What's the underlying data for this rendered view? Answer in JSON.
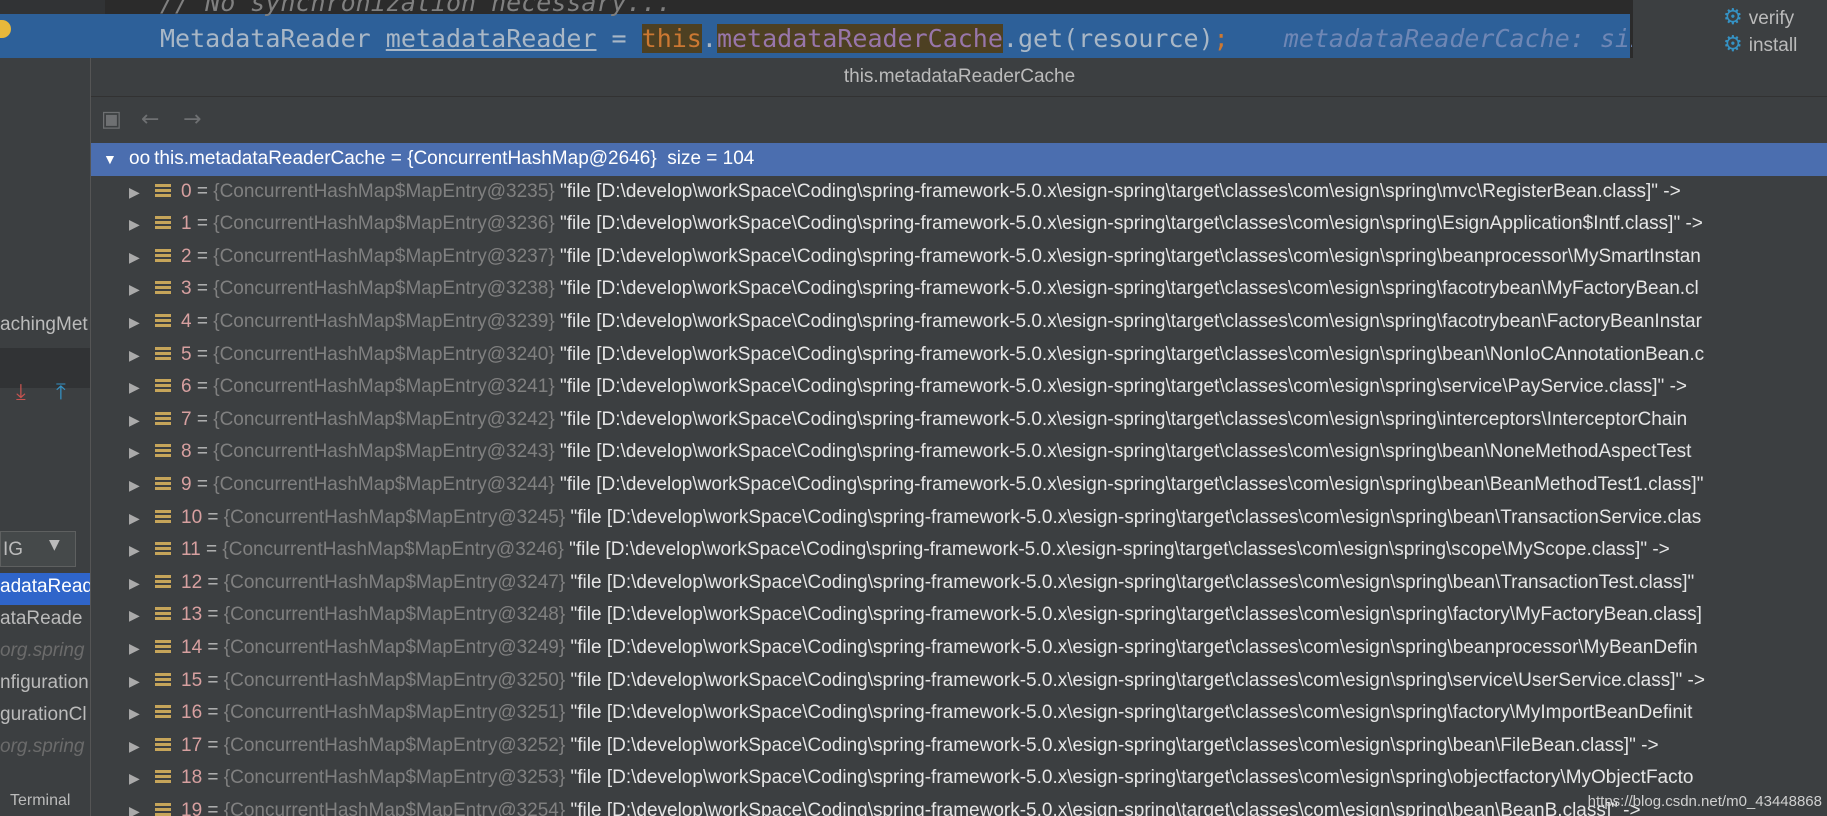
{
  "editor": {
    "prev_line": "// No synchronization necessary...",
    "code": {
      "type": "MetadataReader",
      "var": "metadataReader",
      "assign": " = ",
      "this_kw": "this",
      "dot": ".",
      "field": "metadataReaderCache",
      "call": ".get(resource)",
      "semi": ";",
      "hint": "metadataReaderCache:  size"
    }
  },
  "right_tool": {
    "items": [
      "verify",
      "install"
    ]
  },
  "left_panel": {
    "items": [
      "achingMet",
      "IG",
      "adataRead",
      "ataReade",
      "org.spring",
      "nfiguration",
      "gurationCl",
      "org.spring"
    ],
    "bottom_tab": "Terminal"
  },
  "popup": {
    "title": "this.metadataReaderCache",
    "root": {
      "label": "this.metadataReaderCache",
      "value": "{ConcurrentHashMap@2646}",
      "size": "size = 104"
    },
    "entries": [
      {
        "i": "0",
        "t": "{ConcurrentHashMap$MapEntry@3235}",
        "v": "\"file [D:\\develop\\workSpace\\Coding\\spring-framework-5.0.x\\esign-spring\\target\\classes\\com\\esign\\spring\\mvc\\RegisterBean.class]\" ->"
      },
      {
        "i": "1",
        "t": "{ConcurrentHashMap$MapEntry@3236}",
        "v": "\"file [D:\\develop\\workSpace\\Coding\\spring-framework-5.0.x\\esign-spring\\target\\classes\\com\\esign\\spring\\EsignApplication$Intf.class]\" ->"
      },
      {
        "i": "2",
        "t": "{ConcurrentHashMap$MapEntry@3237}",
        "v": "\"file [D:\\develop\\workSpace\\Coding\\spring-framework-5.0.x\\esign-spring\\target\\classes\\com\\esign\\spring\\beanprocessor\\MySmartInstan"
      },
      {
        "i": "3",
        "t": "{ConcurrentHashMap$MapEntry@3238}",
        "v": "\"file [D:\\develop\\workSpace\\Coding\\spring-framework-5.0.x\\esign-spring\\target\\classes\\com\\esign\\spring\\facotrybean\\MyFactoryBean.cl"
      },
      {
        "i": "4",
        "t": "{ConcurrentHashMap$MapEntry@3239}",
        "v": "\"file [D:\\develop\\workSpace\\Coding\\spring-framework-5.0.x\\esign-spring\\target\\classes\\com\\esign\\spring\\facotrybean\\FactoryBeanInstar"
      },
      {
        "i": "5",
        "t": "{ConcurrentHashMap$MapEntry@3240}",
        "v": "\"file [D:\\develop\\workSpace\\Coding\\spring-framework-5.0.x\\esign-spring\\target\\classes\\com\\esign\\spring\\bean\\NonIoCAnnotationBean.c"
      },
      {
        "i": "6",
        "t": "{ConcurrentHashMap$MapEntry@3241}",
        "v": "\"file [D:\\develop\\workSpace\\Coding\\spring-framework-5.0.x\\esign-spring\\target\\classes\\com\\esign\\spring\\service\\PayService.class]\" ->"
      },
      {
        "i": "7",
        "t": "{ConcurrentHashMap$MapEntry@3242}",
        "v": "\"file [D:\\develop\\workSpace\\Coding\\spring-framework-5.0.x\\esign-spring\\target\\classes\\com\\esign\\spring\\interceptors\\InterceptorChain"
      },
      {
        "i": "8",
        "t": "{ConcurrentHashMap$MapEntry@3243}",
        "v": "\"file [D:\\develop\\workSpace\\Coding\\spring-framework-5.0.x\\esign-spring\\target\\classes\\com\\esign\\spring\\bean\\NoneMethodAspectTest"
      },
      {
        "i": "9",
        "t": "{ConcurrentHashMap$MapEntry@3244}",
        "v": "\"file [D:\\develop\\workSpace\\Coding\\spring-framework-5.0.x\\esign-spring\\target\\classes\\com\\esign\\spring\\bean\\BeanMethodTest1.class]\""
      },
      {
        "i": "10",
        "t": "{ConcurrentHashMap$MapEntry@3245}",
        "v": "\"file [D:\\develop\\workSpace\\Coding\\spring-framework-5.0.x\\esign-spring\\target\\classes\\com\\esign\\spring\\bean\\TransactionService.clas"
      },
      {
        "i": "11",
        "t": "{ConcurrentHashMap$MapEntry@3246}",
        "v": "\"file [D:\\develop\\workSpace\\Coding\\spring-framework-5.0.x\\esign-spring\\target\\classes\\com\\esign\\spring\\scope\\MyScope.class]\" ->"
      },
      {
        "i": "12",
        "t": "{ConcurrentHashMap$MapEntry@3247}",
        "v": "\"file [D:\\develop\\workSpace\\Coding\\spring-framework-5.0.x\\esign-spring\\target\\classes\\com\\esign\\spring\\bean\\TransactionTest.class]\""
      },
      {
        "i": "13",
        "t": "{ConcurrentHashMap$MapEntry@3248}",
        "v": "\"file [D:\\develop\\workSpace\\Coding\\spring-framework-5.0.x\\esign-spring\\target\\classes\\com\\esign\\spring\\factory\\MyFactoryBean.class]"
      },
      {
        "i": "14",
        "t": "{ConcurrentHashMap$MapEntry@3249}",
        "v": "\"file [D:\\develop\\workSpace\\Coding\\spring-framework-5.0.x\\esign-spring\\target\\classes\\com\\esign\\spring\\beanprocessor\\MyBeanDefin"
      },
      {
        "i": "15",
        "t": "{ConcurrentHashMap$MapEntry@3250}",
        "v": "\"file [D:\\develop\\workSpace\\Coding\\spring-framework-5.0.x\\esign-spring\\target\\classes\\com\\esign\\spring\\service\\UserService.class]\" ->"
      },
      {
        "i": "16",
        "t": "{ConcurrentHashMap$MapEntry@3251}",
        "v": "\"file [D:\\develop\\workSpace\\Coding\\spring-framework-5.0.x\\esign-spring\\target\\classes\\com\\esign\\spring\\factory\\MyImportBeanDefinit"
      },
      {
        "i": "17",
        "t": "{ConcurrentHashMap$MapEntry@3252}",
        "v": "\"file [D:\\develop\\workSpace\\Coding\\spring-framework-5.0.x\\esign-spring\\target\\classes\\com\\esign\\spring\\bean\\FileBean.class]\" ->"
      },
      {
        "i": "18",
        "t": "{ConcurrentHashMap$MapEntry@3253}",
        "v": "\"file [D:\\develop\\workSpace\\Coding\\spring-framework-5.0.x\\esign-spring\\target\\classes\\com\\esign\\spring\\objectfactory\\MyObjectFacto"
      },
      {
        "i": "19",
        "t": "{ConcurrentHashMap$MapEntry@3254}",
        "v": "\"file [D:\\develop\\workSpace\\Coding\\spring-framework-5.0.x\\esign-spring\\target\\classes\\com\\esign\\spring\\bean\\BeanB.class]\" ->"
      }
    ],
    "watermark": "https://blog.csdn.net/m0_43448868"
  }
}
